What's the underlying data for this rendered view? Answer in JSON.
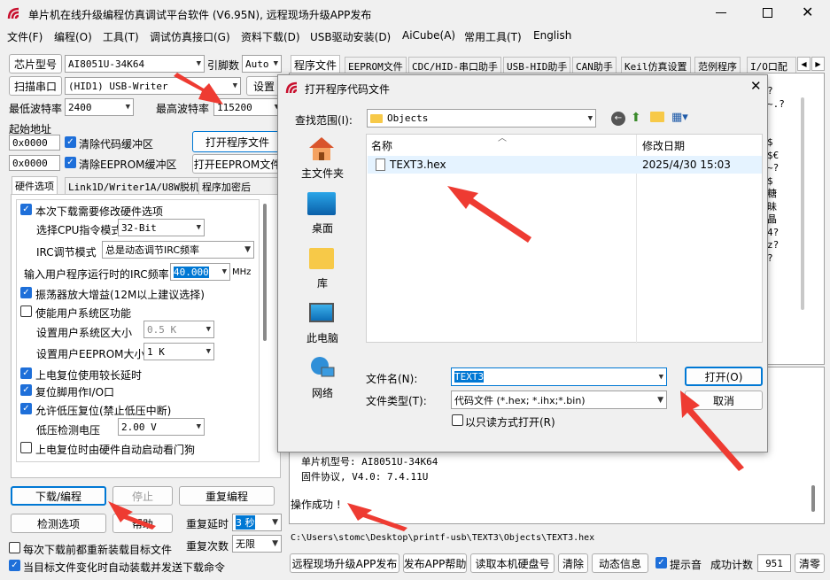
{
  "window": {
    "title": "单片机在线升级编程仿真调试平台软件 (V6.95N), 远程现场升级APP发布"
  },
  "menu": [
    "文件(F)",
    "编程(O)",
    "工具(T)",
    "调试仿真接口(G)",
    "资料下载(D)",
    "USB驱动安装(D)",
    "AiCube(A)",
    "常用工具(T)",
    "English"
  ],
  "left": {
    "chip_label": "芯片型号",
    "chip": "AI8051U-34K64",
    "pin_label": "引脚数",
    "pin": "Auto",
    "scan_btn": "扫描串口",
    "port": "(HID1) USB-Writer",
    "settings_btn": "设置",
    "min_baud_label": "最低波特率",
    "min_baud": "2400",
    "max_baud_label": "最高波特率",
    "max_baud": "115200",
    "start_addr_label": "起始地址",
    "addr1": "0x0000",
    "clear_code": "清除代码缓冲区",
    "open_prog": "打开程序文件",
    "addr2": "0x0000",
    "clear_eeprom": "清除EEPROM缓冲区",
    "open_eeprom": "打开EEPROM文件",
    "tabs": [
      "硬件选项",
      "Link1D/Writer1A/U8W脱机",
      "程序加密后"
    ],
    "hw": {
      "modify": "本次下载需要修改硬件选项",
      "cpu_label": "选择CPU指令模式",
      "cpu": "32-Bit",
      "irc_label": "IRC调节模式",
      "irc": "总是动态调节IRC频率",
      "freq_label": "输入用户程序运行时的IRC频率",
      "freq": "40.000",
      "mhz": "MHz",
      "osc": "振荡器放大增益(12M以上建议选择)",
      "sysarea": "使能用户系统区功能",
      "sysarea_size_label": "设置用户系统区大小",
      "sysarea_size": "0.5 K",
      "eeprom_size_label": "设置用户EEPROM大小",
      "eeprom_size": "1   K",
      "long_delay": "上电复位使用较长延时",
      "reset_io": "复位脚用作I/O口",
      "lvr": "允许低压复位(禁止低压中断)",
      "lvd_label": "低压检测电压",
      "lvd": "2.00 V",
      "watchdog": "上电复位时由硬件自动启动看门狗"
    },
    "download_btn": "下载/编程",
    "stop_btn": "停止",
    "reprogram_btn": "重复编程",
    "detect_btn": "检测选项",
    "help_btn": "帮助",
    "repeat_delay_label": "重复延时",
    "repeat_delay": "3 秒",
    "repeat_count_label": "重复次数",
    "repeat_count": "无限",
    "reload_each": "每次下载前都重新装载目标文件",
    "auto_reload": "当目标文件变化时自动装载并发送下载命令"
  },
  "right": {
    "tabs": [
      "程序文件",
      "EEPROM文件",
      "CDC/HID-串口助手",
      "USB-HID助手",
      "CAN助手",
      "Keil仿真设置",
      "范例程序",
      "I/O口配"
    ],
    "hex_chars": [
      "?",
      "~.?",
      "",
      "",
      "$",
      "$€",
      "~?",
      "$",
      "糖",
      "昧",
      "晶",
      "4?",
      "z?",
      "?"
    ],
    "log_model": "单片机型号: AI8051U-34K64",
    "log_protocol": "固件协议, V4.0: 7.4.11U",
    "success": "操作成功 !",
    "path": "C:\\Users\\stomc\\Desktop\\printf-usb\\TEXT3\\Objects\\TEXT3.hex",
    "remote_btn": "远程现场升级APP发布",
    "publish_help_btn": "发布APP帮助",
    "read_disk_btn": "读取本机硬盘号",
    "clear_btn": "清除",
    "dyn_btn": "动态信息",
    "beep": "提示音",
    "count_label": "成功计数",
    "count": "951",
    "reset_btn": "清零"
  },
  "dialog": {
    "title": "打开程序代码文件",
    "look_in_label": "查找范围(I):",
    "folder": "Objects",
    "places": [
      "主文件夹",
      "桌面",
      "库",
      "此电脑",
      "网络"
    ],
    "col_name": "名称",
    "col_date": "修改日期",
    "file_name": "TEXT3.hex",
    "file_date": "2025/4/30 15:03",
    "filename_label": "文件名(N):",
    "filename": "TEXT3",
    "filetype_label": "文件类型(T):",
    "filetype": "代码文件 (*.hex; *.ihx;*.bin)",
    "readonly": "以只读方式打开(R)",
    "open_btn": "打开(O)",
    "cancel_btn": "取消"
  }
}
